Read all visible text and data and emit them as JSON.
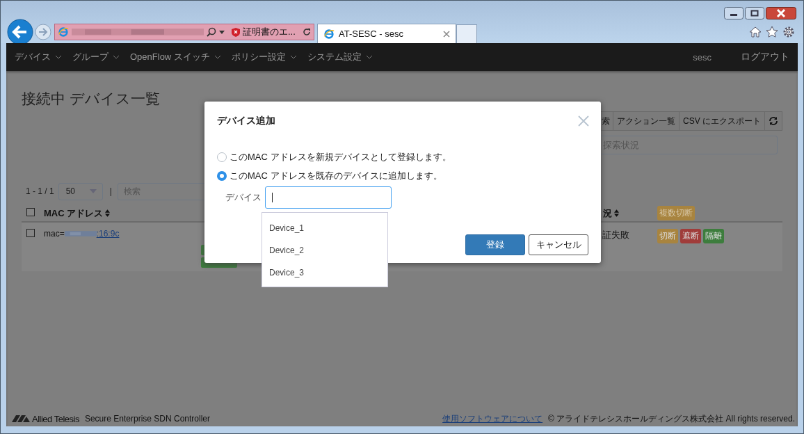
{
  "browser": {
    "address": {
      "status": "証明書のエ..."
    },
    "tab": {
      "title": "AT-SESC - sesc",
      "selected": true
    }
  },
  "nav": {
    "items": [
      "デバイス",
      "グループ",
      "OpenFlow スイッチ",
      "ポリシー設定",
      "システム設定"
    ],
    "user": "sesc",
    "logout": "ログアウト"
  },
  "page": {
    "title": "接続中 デバイス一覧",
    "toolbar": [
      "索",
      "アクション一覧",
      "CSV にエクスポート"
    ],
    "discovery_field": {
      "placeholder": "探索状況"
    },
    "pagination": "1 - 1 / 1",
    "page_size": "50",
    "separator": "|",
    "search": {
      "placeholder": "検索"
    },
    "table": {
      "header_checked": false,
      "columns": [
        {
          "label": "MAC アドレス",
          "sortable": true
        },
        {
          "label": "況",
          "sortable": true
        }
      ],
      "bulk_action": {
        "label": "複数切断",
        "color": "#a8843f"
      },
      "rows": [
        {
          "checked": false,
          "mac_prefix": "mac=",
          "mac_link": ":16:9c",
          "tags": [
            {
              "color": "#3d7d3d"
            },
            {
              "color": "#3d7d3d"
            }
          ],
          "status": "証失敗",
          "actions": [
            {
              "label": "切断",
              "color": "#a8843f"
            },
            {
              "label": "遮断",
              "color": "#a03c3a"
            },
            {
              "label": "隔離",
              "color": "#3d7d3d"
            }
          ]
        }
      ]
    }
  },
  "dialog": {
    "title": "デバイス追加",
    "options": [
      {
        "label": "このMAC アドレスを新規デバイスとして登録します。",
        "selected": false
      },
      {
        "label": "このMAC アドレスを既存のデバイスに追加します。",
        "selected": true
      }
    ],
    "field_label": "デバイス",
    "suggestions": [
      "Device_1",
      "Device_2",
      "Device_3"
    ],
    "buttons": [
      {
        "label": "登録",
        "kind": "primary"
      },
      {
        "label": "キャンセル",
        "kind": "default"
      }
    ]
  },
  "footer": {
    "logo": "Allied Telesis",
    "product": "Secure Enterprise SDN Controller",
    "link": "使用ソフトウェアについて",
    "copyright": "© アライドテレシスホールディングス株式会社 All rights reserved."
  }
}
